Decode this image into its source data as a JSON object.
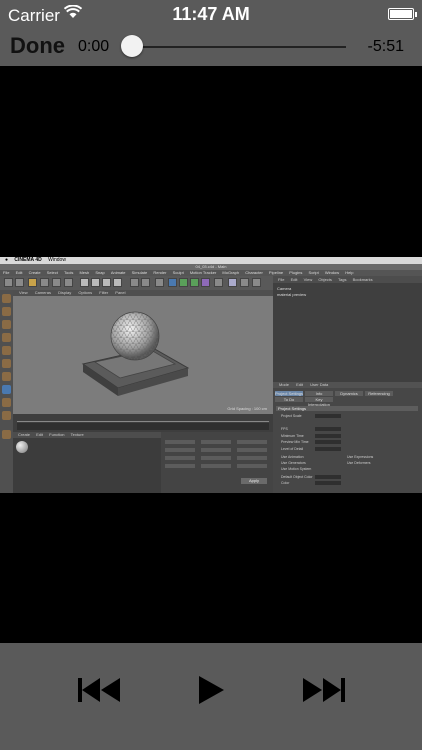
{
  "status_bar": {
    "carrier": "Carrier",
    "time": "11:47 AM"
  },
  "player": {
    "done_label": "Done",
    "elapsed": "0:00",
    "remaining": "-5:51",
    "progress_fraction": 0.0
  },
  "video_frame": {
    "app_name": "CINEMA 4D",
    "window_menu": "Window",
    "doc_title": "04_03.c4d - Main",
    "app_menu": [
      "File",
      "Edit",
      "Create",
      "Select",
      "Tools",
      "Mesh",
      "Snap",
      "Animate",
      "Simulate",
      "Render",
      "Sculpt",
      "Motion Tracker",
      "MoGraph",
      "Character",
      "Pipeline",
      "Plugins",
      "Script",
      "Window",
      "Help"
    ],
    "viewport_menu": [
      "View",
      "Cameras",
      "Display",
      "Options",
      "Filter",
      "Panel"
    ],
    "viewport_grid": "Grid Spacing : 100 cm",
    "material_menu": [
      "Create",
      "Edit",
      "Function",
      "Texture"
    ],
    "objects_menu": [
      "File",
      "Edit",
      "View",
      "Objects",
      "Tags",
      "Bookmarks"
    ],
    "objects": [
      "Camera",
      "material preview"
    ],
    "attr_menu": [
      "Mode",
      "Edit",
      "User Data"
    ],
    "attr_tabs": [
      "Project Settings",
      "Info",
      "Dynamics",
      "Referencing",
      "To Do",
      "Key Interpolation"
    ],
    "section_title": "Project Settings",
    "fields": [
      "Project Scale",
      "FPS",
      "Minimum Time",
      "Preview Min Time",
      "Level of Detail",
      "Use Animation",
      "Use Expressions",
      "Use Generators",
      "Use Deformers",
      "Use Motion System",
      "Default Object Color",
      "Color"
    ],
    "apply_label": "Apply"
  },
  "controls": {
    "previous": "skip-previous",
    "play": "play",
    "next": "skip-next"
  }
}
